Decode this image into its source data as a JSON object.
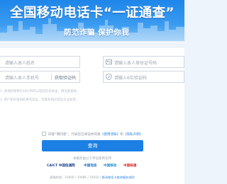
{
  "banner": {
    "title": "全国移动电话卡“一证通查”",
    "subtitle": "防范诈骗 保护你我"
  },
  "form": {
    "name_placeholder": "请输入本人姓名",
    "id_placeholder": "请输入本人身份证号码",
    "phone_placeholder": "请输入本人手机号",
    "get_code_label": "获取验证码",
    "code_placeholder": "请输入6位验证码"
  },
  "notes": [
    "1. 查询结果将在48小时内以短信形式发送，请注意查收。",
    "2. 用户如对查询结果有异议，可联系相应电信企业处理。"
  ],
  "agreement": {
    "prefix": "同意“我同意”，代表您已阅读并同意",
    "link1": "《使用须知》",
    "middle": "和",
    "link2": "《隐私声明》"
  },
  "query_button_label": "查询",
  "support_label": "本服务由以下单位提供支持",
  "logos": [
    {
      "name": "CAICT 中国信通院",
      "color": "#1a3f8f"
    },
    {
      "name": "中国电信",
      "color": "#1a6fc6"
    },
    {
      "name": "中国移动",
      "color": "#1a8fd0"
    },
    {
      "name": "中国联通",
      "color": "#d42a2a"
    }
  ],
  "footer": {
    "prefix": "客服热线：10000 / 10086 / 10010 | ",
    "link": "移动电话卡查询服务说明"
  }
}
